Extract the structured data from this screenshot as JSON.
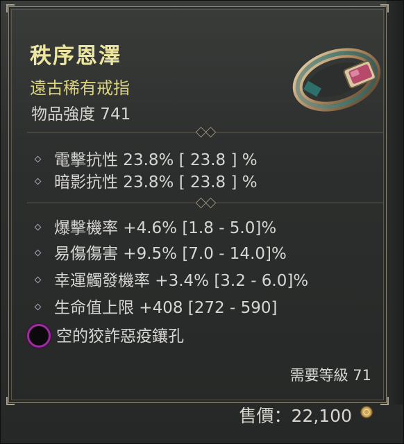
{
  "item": {
    "name": "秩序恩澤",
    "type": "遠古稀有戒指",
    "power": "物品強度 741",
    "icon": "ring-icon"
  },
  "defensive_stats": [
    {
      "text": "電擊抗性 23.8%   [ 23.8 ] %"
    },
    {
      "text": "暗影抗性 23.8%   [ 23.8 ] %"
    }
  ],
  "affixes": [
    {
      "text": "爆擊機率 +4.6% [1.8 - 5.0]%"
    },
    {
      "text": "易傷傷害 +9.5% [7.0 - 14.0]%"
    },
    {
      "text": "幸運觸發機率 +3.4% [3.2 - 6.0]%"
    },
    {
      "text": "生命值上限 +408 [272 - 590]"
    }
  ],
  "socket": {
    "label": "空的狡詐惡疫鑲孔",
    "icon": "empty-socket-icon",
    "color": "#9b2e9e"
  },
  "requirement": "需要等級 71",
  "sell_price": "售價：22,100",
  "colors": {
    "title": "#ece6a1",
    "rarity": "#dcd47c",
    "text": "#d6d6d3"
  }
}
